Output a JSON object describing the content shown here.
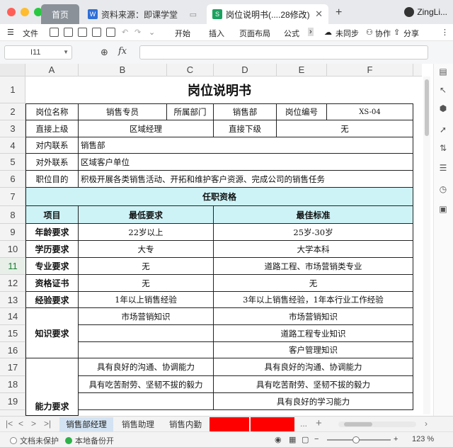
{
  "titlebar": {
    "tabs": [
      {
        "label": "首页"
      },
      {
        "label": "资料来源：即课学堂",
        "icon": "W"
      },
      {
        "label": "岗位说明书(....28修改)",
        "icon": "S"
      }
    ],
    "user": "ZingLi..."
  },
  "menubar": {
    "file": "文件",
    "items": [
      "开始",
      "插入",
      "页面布局",
      "公式"
    ],
    "sync": "未同步",
    "collab": "协作",
    "share": "分享"
  },
  "formula": {
    "cell_ref": "I11",
    "fx": "fx",
    "value": ""
  },
  "columns": [
    "A",
    "B",
    "C",
    "D",
    "E",
    "F"
  ],
  "rows": [
    "1",
    "2",
    "3",
    "4",
    "5",
    "6",
    "7",
    "8",
    "9",
    "10",
    "11",
    "12",
    "13",
    "14",
    "15",
    "16",
    "17",
    "18",
    "19"
  ],
  "sheet": {
    "title": "岗位说明书",
    "r2": {
      "a": "岗位名称",
      "b": "销售专员",
      "c": "所属部门",
      "d": "销售部",
      "e": "岗位编号",
      "f": "XS-04"
    },
    "r3": {
      "a": "直接上级",
      "b": "区域经理",
      "d": "直接下级",
      "f": "无"
    },
    "r4": {
      "a": "对内联系",
      "b": "销售部"
    },
    "r5": {
      "a": "对外联系",
      "b": "区域客户单位"
    },
    "r6": {
      "a": "职位目的",
      "b": "积极开展各类销售活动、开拓和维护客户资源、完成公司的销售任务"
    },
    "r7": {
      "a": "任职资格"
    },
    "r8": {
      "a": "项目",
      "b": "最低要求",
      "d": "最佳标准"
    },
    "r9": {
      "a": "年龄要求",
      "b": "22岁以上",
      "d": "25岁-30岁"
    },
    "r10": {
      "a": "学历要求",
      "b": "大专",
      "d": "大学本科"
    },
    "r11": {
      "a": "专业要求",
      "b": "无",
      "d": "道路工程、市场营销类专业"
    },
    "r12": {
      "a": "资格证书",
      "b": "无",
      "d": "无"
    },
    "r13": {
      "a": "经验要求",
      "b": "1年以上销售经验",
      "d": "3年以上销售经验，1年本行业工作经验"
    },
    "r14": {
      "a": "知识要求",
      "b": "市场营销知识",
      "d": "市场营销知识"
    },
    "r15": {
      "d": "道路工程专业知识"
    },
    "r16": {
      "d": "客户管理知识"
    },
    "r17": {
      "a": "能力要求",
      "b": "具有良好的沟通、协调能力",
      "d": "具有良好的沟通、协调能力"
    },
    "r18": {
      "b": "具有吃苦耐劳、坚韧不拔的毅力",
      "d": "具有吃苦耐劳、坚韧不拔的毅力"
    },
    "r19": {
      "d": "具有良好的学习能力"
    }
  },
  "sheet_tabs": [
    "销售部经理",
    "销售助理",
    "销售内勤"
  ],
  "sheet_tabs_more": "...",
  "status": {
    "protect": "文档未保护",
    "backup": "本地备份开",
    "zoom": "123 %"
  },
  "colors": {
    "cyan_header": "#cdf3f7",
    "active_tab": "#d3e3f3",
    "red_tab": "#ff0000"
  }
}
